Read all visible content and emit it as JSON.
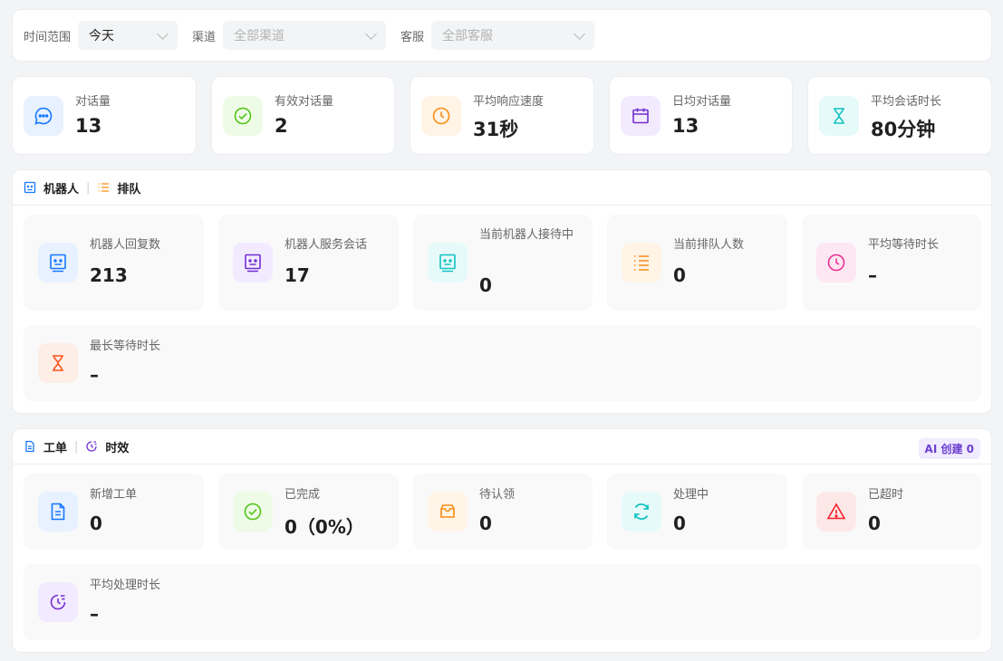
{
  "filters": {
    "time_label": "时间范围",
    "time_value": "今天",
    "channel_label": "渠道",
    "channel_value": "全部渠道",
    "agent_label": "客服",
    "agent_value": "全部客服"
  },
  "top_stats": [
    {
      "label": "对话量",
      "value": "13",
      "icon": "chat-bubble-icon",
      "color": "#1677ff"
    },
    {
      "label": "有效对话量",
      "value": "2",
      "icon": "check-circle-icon",
      "color": "#52c41a"
    },
    {
      "label": "平均响应速度",
      "value": "31秒",
      "icon": "clock-icon",
      "color": "#fa8c16"
    },
    {
      "label": "日均对话量",
      "value": "13",
      "icon": "calendar-icon",
      "color": "#722ed1"
    },
    {
      "label": "平均会话时长",
      "value": "80分钟",
      "icon": "hourglass-icon",
      "color": "#13c2c2"
    }
  ],
  "robot_section": {
    "tab_robot": "机器人",
    "tab_queue": "排队",
    "stats": [
      {
        "label": "机器人回复数",
        "value": "213",
        "icon": "robot-icon",
        "color": "#1677ff"
      },
      {
        "label": "机器人服务会话",
        "value": "17",
        "icon": "robot-icon",
        "color": "#722ed1"
      },
      {
        "label": "当前机器人接待中",
        "value": "0",
        "icon": "robot-icon",
        "color": "#13c2c2"
      },
      {
        "label": "当前排队人数",
        "value": "0",
        "icon": "list-icon",
        "color": "#fa8c16"
      },
      {
        "label": "平均等待时长",
        "value": "–",
        "icon": "clock-icon",
        "color": "#eb2f96"
      },
      {
        "label": "最长等待时长",
        "value": "–",
        "icon": "hourglass-icon",
        "color": "#fa541c"
      }
    ]
  },
  "ticket_section": {
    "tab_ticket": "工单",
    "tab_timing": "时效",
    "ai_badge": "AI 创建 0",
    "stats": [
      {
        "label": "新增工单",
        "value": "0",
        "icon": "document-icon",
        "color": "#1677ff"
      },
      {
        "label": "已完成",
        "value": "0（0%）",
        "icon": "check-circle-icon",
        "color": "#52c41a"
      },
      {
        "label": "待认领",
        "value": "0",
        "icon": "inbox-icon",
        "color": "#fa8c16"
      },
      {
        "label": "处理中",
        "value": "0",
        "icon": "refresh-icon",
        "color": "#13c2c2"
      },
      {
        "label": "已超时",
        "value": "0",
        "icon": "warning-icon",
        "color": "#f5222d"
      },
      {
        "label": "平均处理时长",
        "value": "–",
        "icon": "timer-icon",
        "color": "#722ed1"
      }
    ]
  }
}
